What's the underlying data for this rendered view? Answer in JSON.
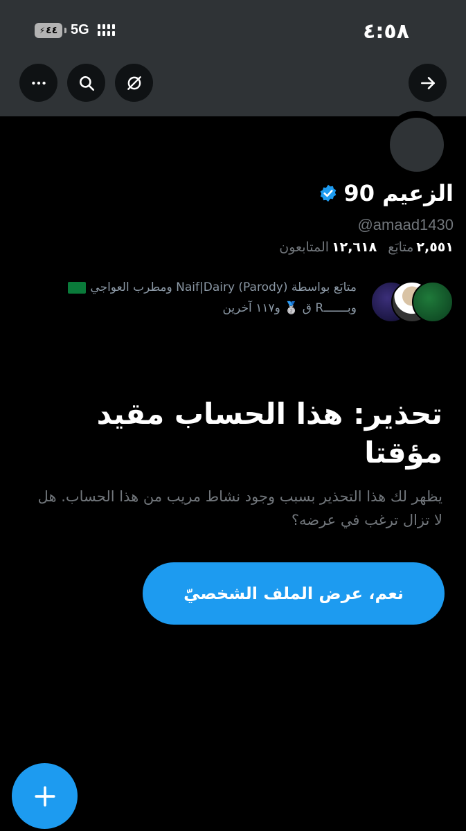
{
  "status_bar": {
    "time": "٤:٥٨",
    "battery": "٤٤",
    "network": "5G"
  },
  "header_buttons": {
    "back_icon": "arrow-right-icon",
    "grok_icon": "grok-icon",
    "search_icon": "search-icon",
    "more_icon": "more-icon"
  },
  "profile": {
    "name": "الزعيم 90",
    "handle": "@amaad1430",
    "following_count": "٢,٥٥١",
    "following_label": "متابَع",
    "followers_count": "١٢,٦١٨",
    "followers_label": "المتابعون",
    "followed_by_line1": "متابَع بواسطة Naif|Dairy (Parody) ومطرب العواجي",
    "followed_by_line2": "وبـــــــR ق 🥈 و١١٧ آخرين"
  },
  "warning": {
    "title": "تحذير: هذا الحساب مقيد مؤقتا",
    "description": "يظهر لك هذا التحذير بسبب وجود نشاط مريب من هذا الحساب. هل لا تزال ترغب في عرضه؟",
    "button_label": "نعم، عرض الملف الشخصيّ"
  },
  "colors": {
    "accent": "#1d9bf0",
    "header_bg": "#2f3336",
    "background": "#000000",
    "muted_text": "#71767b"
  }
}
